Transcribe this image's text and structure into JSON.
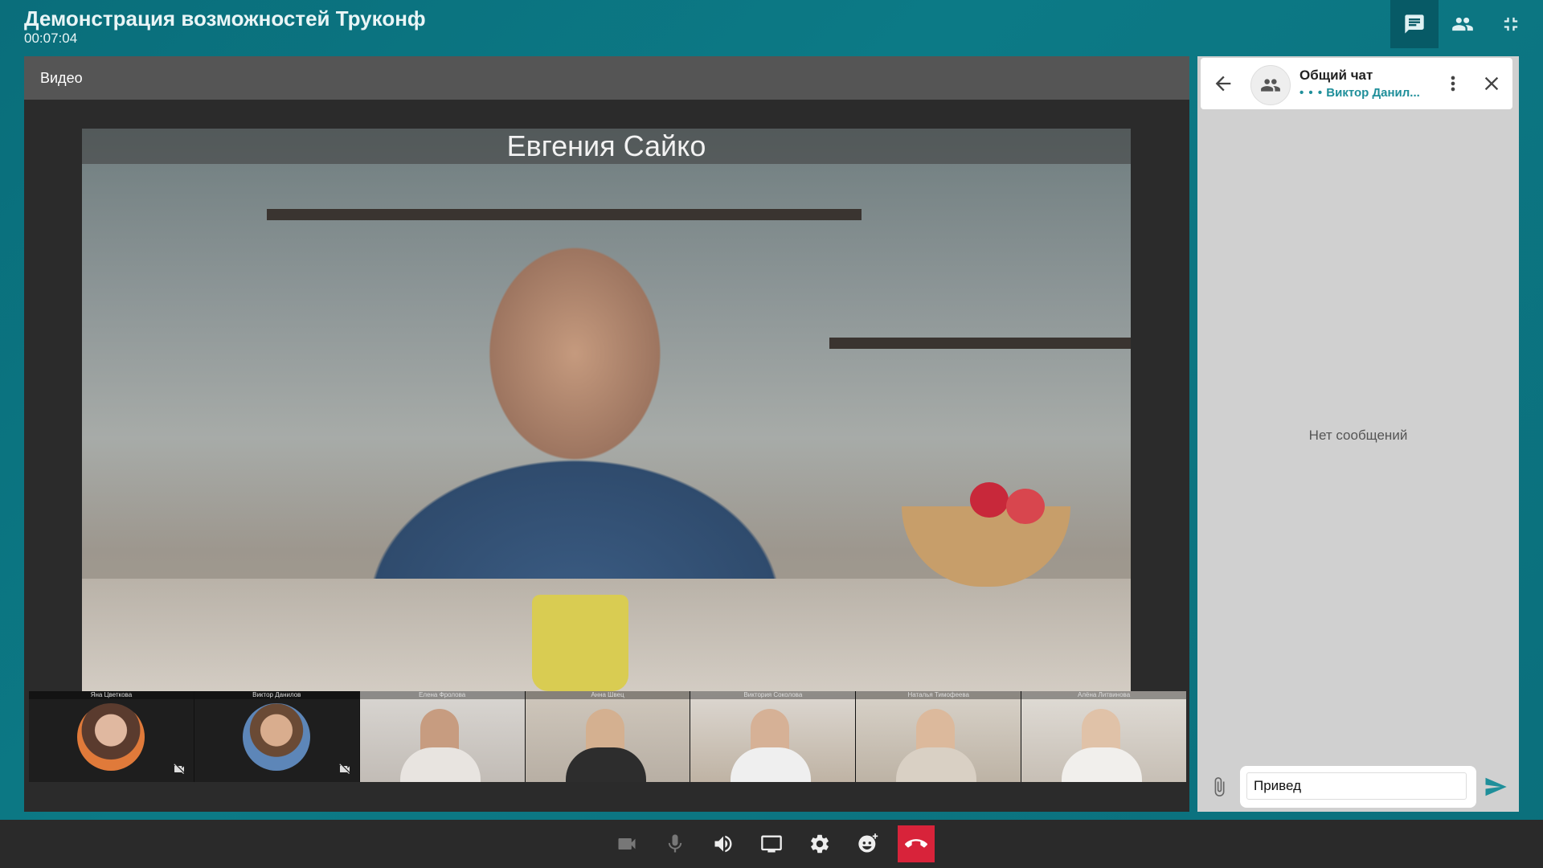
{
  "header": {
    "title": "Демонстрация возможностей Труконф",
    "timer": "00:07:04"
  },
  "top_actions": [
    {
      "name": "chat-icon",
      "active": true
    },
    {
      "name": "participants-icon",
      "active": false
    },
    {
      "name": "collapse-icon",
      "active": false
    }
  ],
  "video_panel": {
    "label": "Видео",
    "speaker_name": "Евгения Сайко"
  },
  "participants": [
    {
      "name": "Яна Цветкова",
      "camera_off": true
    },
    {
      "name": "Виктор Данилов",
      "camera_off": true
    },
    {
      "name": "Елена Фролова",
      "camera_off": false
    },
    {
      "name": "Анна Швец",
      "camera_off": false
    },
    {
      "name": "Виктория Соколова",
      "camera_off": false
    },
    {
      "name": "Наталья Тимофеева",
      "camera_off": false
    },
    {
      "name": "Алёна Литвинова",
      "camera_off": false
    }
  ],
  "chat": {
    "title": "Общий чат",
    "typing": "Виктор Данил...",
    "empty_text": "Нет сообщений",
    "input_value": "Привед"
  },
  "controls": [
    "camera-icon",
    "microphone-icon",
    "speaker-icon",
    "screen-share-icon",
    "settings-icon",
    "reaction-icon",
    "hangup-icon"
  ],
  "colors": {
    "accent": "#0b6f7c",
    "hangup": "#d8233a",
    "typing": "#1f8f9a"
  }
}
